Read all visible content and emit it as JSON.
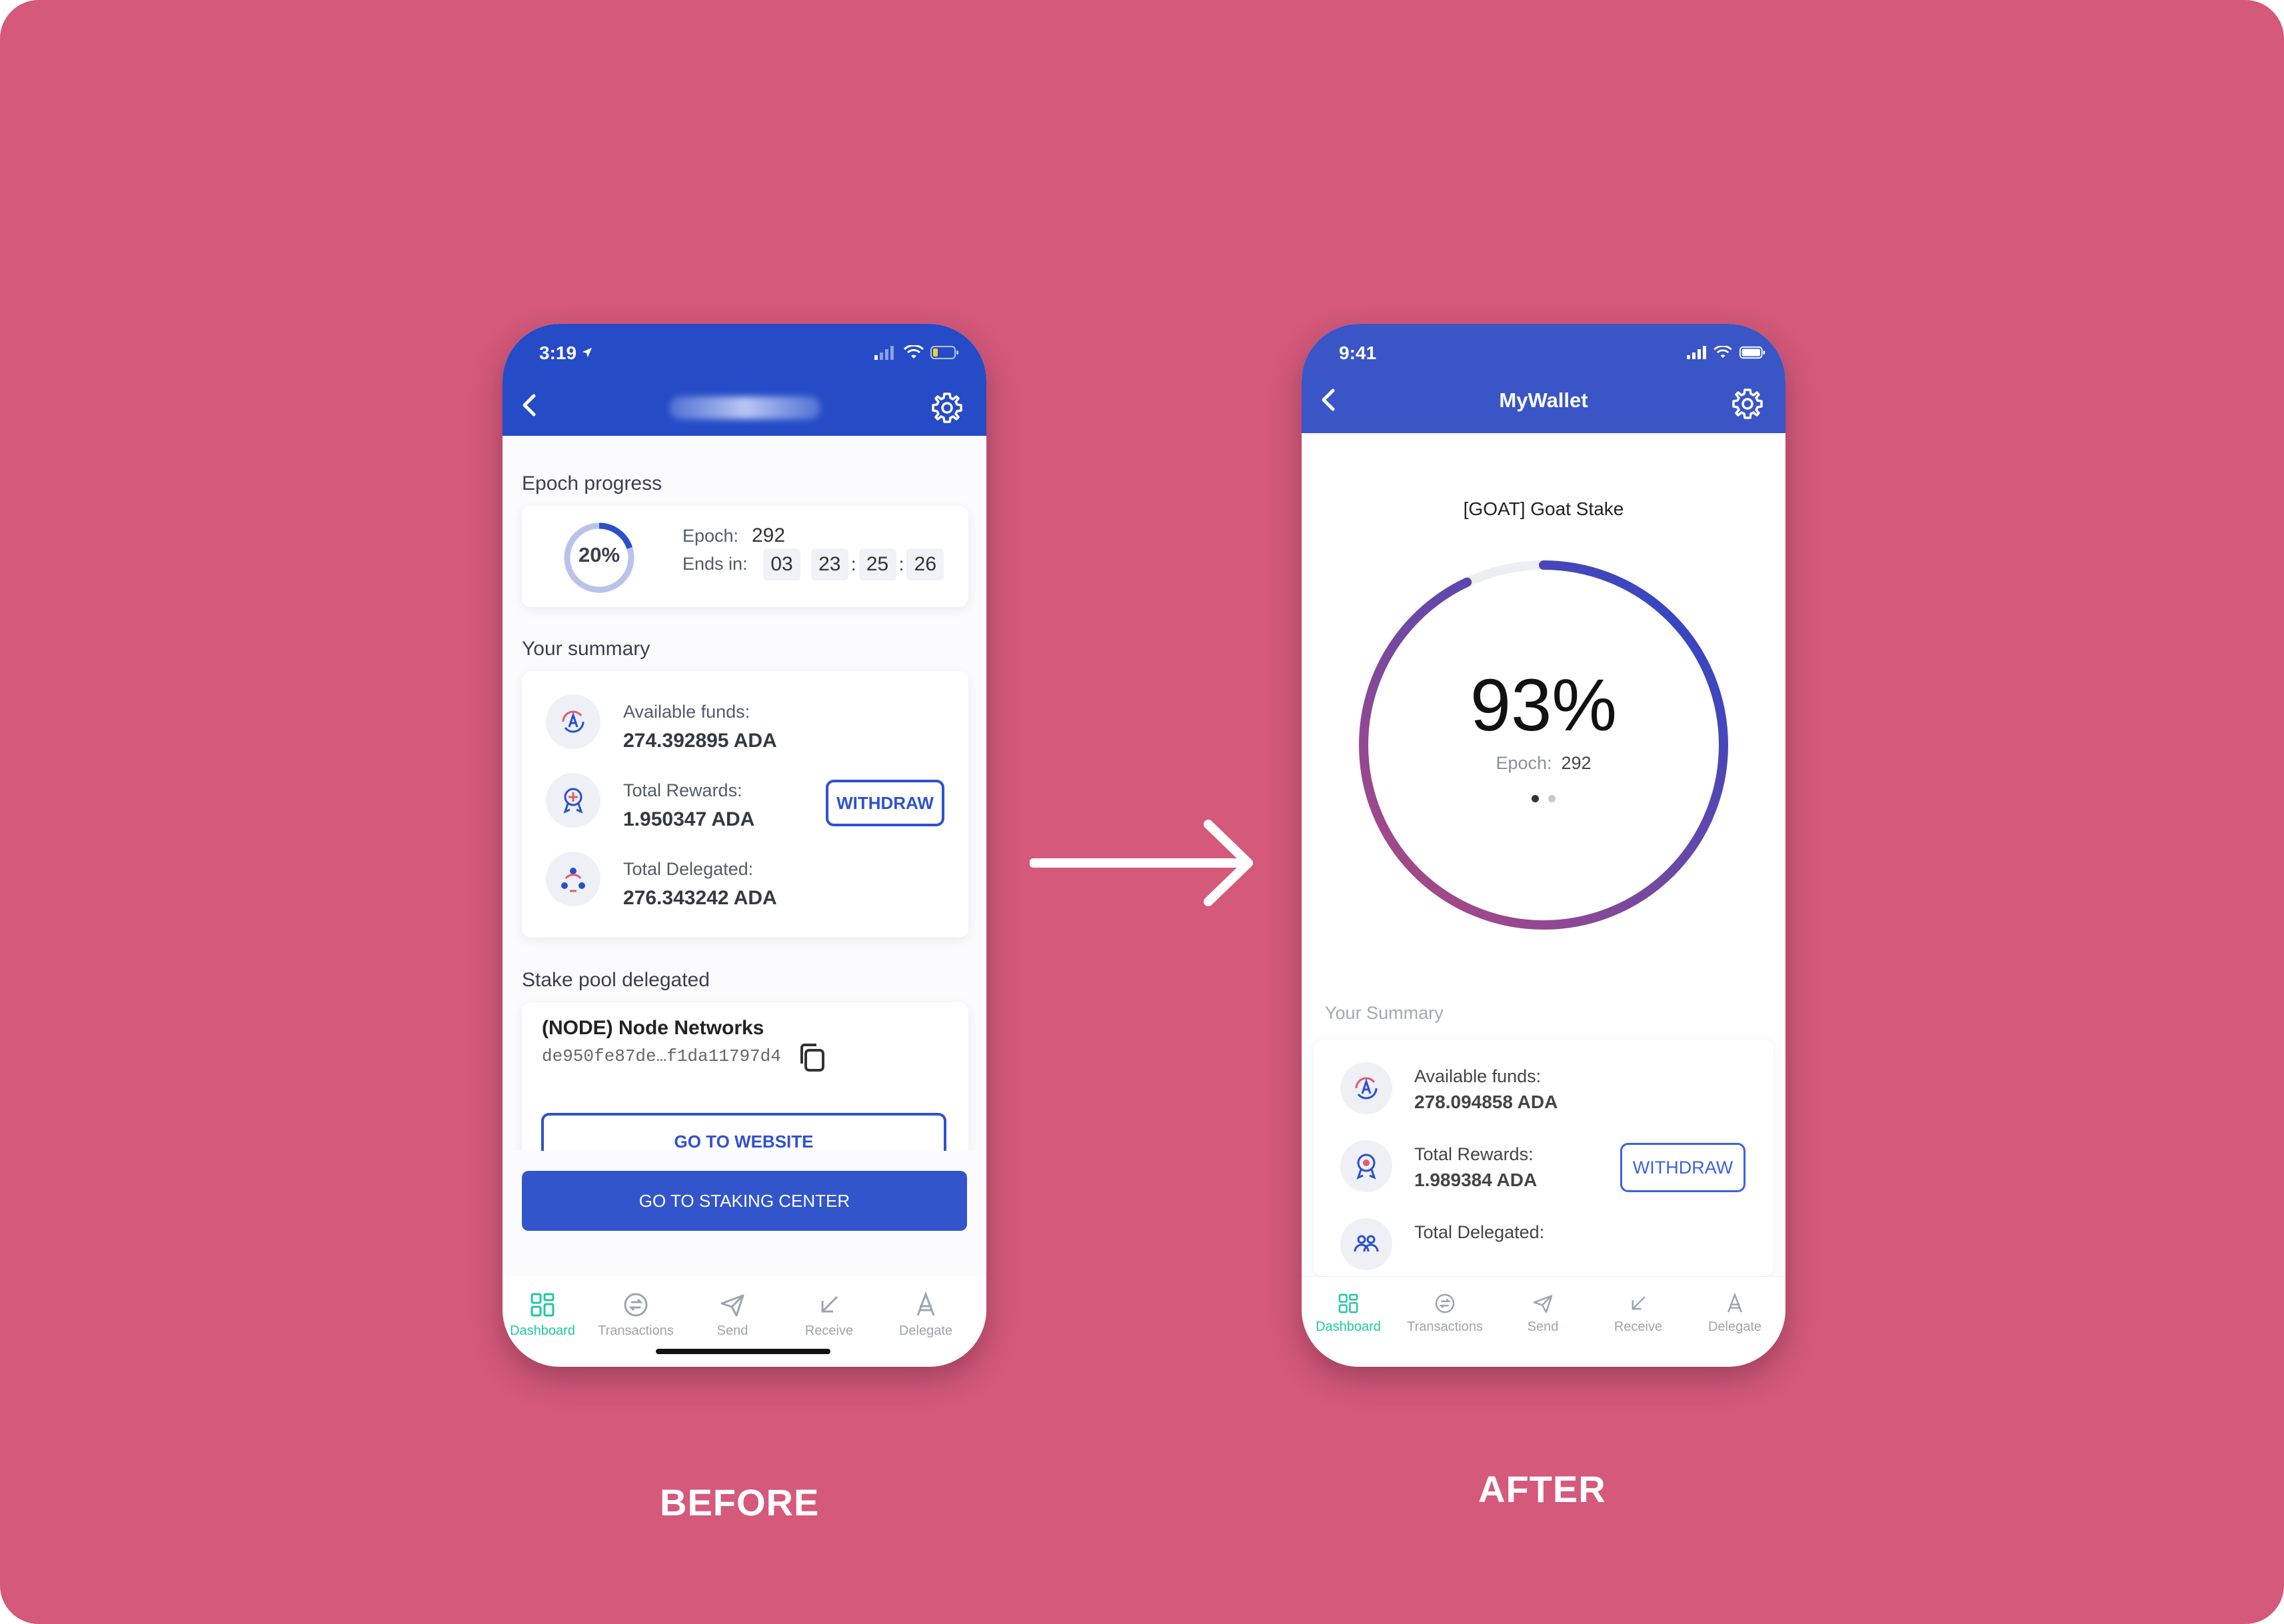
{
  "before": {
    "caption": "BEFORE",
    "status_time": "3:19",
    "epoch_section_title": "Epoch progress",
    "epoch_percent": "20%",
    "epoch_progress_fraction": 0.2,
    "epoch_label": "Epoch:",
    "epoch_value": "292",
    "ends_in_label": "Ends in:",
    "ends_in": [
      "03",
      "23",
      "25",
      "26"
    ],
    "summary_title": "Your summary",
    "available_label": "Available funds:",
    "available_value": "274.392895 ADA",
    "rewards_label": "Total Rewards:",
    "rewards_value": "1.950347 ADA",
    "withdraw_label": "WITHDRAW",
    "delegated_label": "Total Delegated:",
    "delegated_value": "276.343242 ADA",
    "pool_section_title": "Stake pool delegated",
    "pool_name": "(NODE) Node Networks",
    "pool_id": "de950fe87de…f1da11797d4",
    "website_button": "GO TO WEBSITE",
    "staking_button": "GO TO STAKING CENTER",
    "nav": [
      {
        "label": "Dashboard",
        "icon": "dashboard-icon"
      },
      {
        "label": "Transactions",
        "icon": "transactions-icon"
      },
      {
        "label": "Send",
        "icon": "send-icon"
      },
      {
        "label": "Receive",
        "icon": "receive-icon"
      },
      {
        "label": "Delegate",
        "icon": "delegate-icon"
      }
    ]
  },
  "after": {
    "caption": "AFTER",
    "status_time": "9:41",
    "app_title": "MyWallet",
    "pool_name": "[GOAT] Goat Stake",
    "epoch_percent": "93%",
    "epoch_progress_fraction": 0.93,
    "epoch_label": "Epoch:",
    "epoch_value": "292",
    "summary_title": "Your Summary",
    "available_label": "Available funds:",
    "available_value": "278.094858 ADA",
    "rewards_label": "Total Rewards:",
    "rewards_value": "1.989384 ADA",
    "withdraw_label": "WITHDRAW",
    "delegated_label": "Total Delegated:",
    "nav": [
      {
        "label": "Dashboard",
        "icon": "dashboard-icon"
      },
      {
        "label": "Transactions",
        "icon": "transactions-icon"
      },
      {
        "label": "Send",
        "icon": "send-icon"
      },
      {
        "label": "Receive",
        "icon": "receive-icon"
      },
      {
        "label": "Delegate",
        "icon": "delegate-icon"
      }
    ]
  },
  "colors": {
    "background": "#d4597a",
    "header_before": "#254bc6",
    "header_after": "#3a55c6",
    "accent_blue": "#2f52cc",
    "active_nav": "#1fc7a0",
    "ring_gradient_start": "#b6497e",
    "ring_gradient_end": "#2446cc"
  }
}
